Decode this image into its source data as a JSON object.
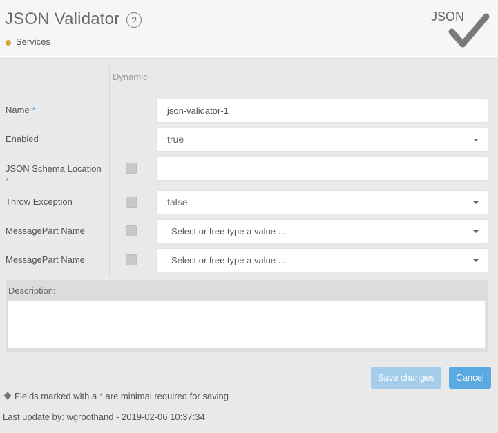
{
  "header": {
    "title": "JSON Validator",
    "help_symbol": "?",
    "service_label": "Services",
    "logo_text": "JSON",
    "status_color": "#d9a33b"
  },
  "form": {
    "dynamic_header": "Dynamic",
    "required_mark": "*",
    "fields": [
      {
        "label": "Name",
        "required": true,
        "value": "json-validator-1"
      },
      {
        "label": "Enabled",
        "value": "true"
      },
      {
        "label": "JSON Schema Location",
        "required": true,
        "value": ""
      },
      {
        "label": "Throw Exception",
        "value": "false"
      },
      {
        "label": "MessagePart Name",
        "placeholder": "Select or free type a value ..."
      },
      {
        "label": "MessagePart Name",
        "placeholder": "Select or free type a value ..."
      }
    ],
    "description_label": "Description:",
    "description_value": ""
  },
  "actions": {
    "save_label": "Save changes",
    "cancel_label": "Cancel",
    "accent_color": "#5aa9e1"
  },
  "footer": {
    "legend_prefix": "Fields marked with a",
    "legend_mark": "*",
    "legend_suffix": "are minimal required for saving",
    "last_update": "Last update by: wgroothand - 2019-02-06 10:37:34"
  }
}
